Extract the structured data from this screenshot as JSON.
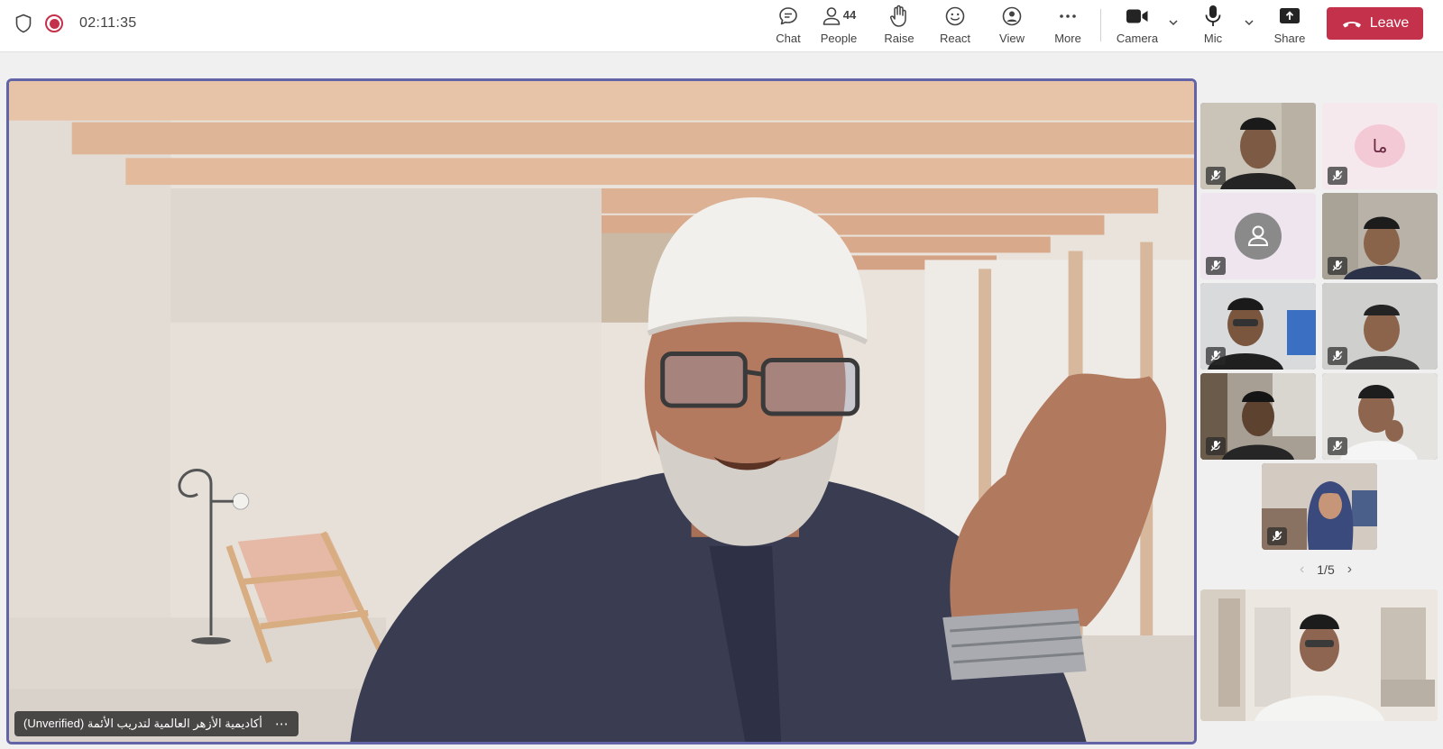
{
  "meeting": {
    "timer": "02:11:35"
  },
  "toolbar": {
    "chat_label": "Chat",
    "people_label": "People",
    "people_count": "44",
    "raise_label": "Raise",
    "react_label": "React",
    "view_label": "View",
    "more_label": "More",
    "camera_label": "Camera",
    "mic_label": "Mic",
    "share_label": "Share",
    "leave_label": "Leave"
  },
  "stage": {
    "speaker_name": "أكاديمية الأزهر العالمية لتدريب الأئمة (Unverified)"
  },
  "gallery": {
    "tiles": [
      {
        "type": "video",
        "muted": true
      },
      {
        "type": "initials",
        "initials": "ما",
        "muted": true
      },
      {
        "type": "avatar",
        "muted": true
      },
      {
        "type": "video",
        "muted": true
      },
      {
        "type": "video",
        "muted": true
      },
      {
        "type": "video",
        "muted": true
      },
      {
        "type": "video",
        "muted": true
      },
      {
        "type": "video",
        "muted": true
      },
      {
        "type": "video",
        "muted": true
      }
    ],
    "page_indicator": "1/5"
  },
  "colors": {
    "accent": "#6264a7",
    "leave": "#c4314b",
    "recording": "#c4314b"
  }
}
